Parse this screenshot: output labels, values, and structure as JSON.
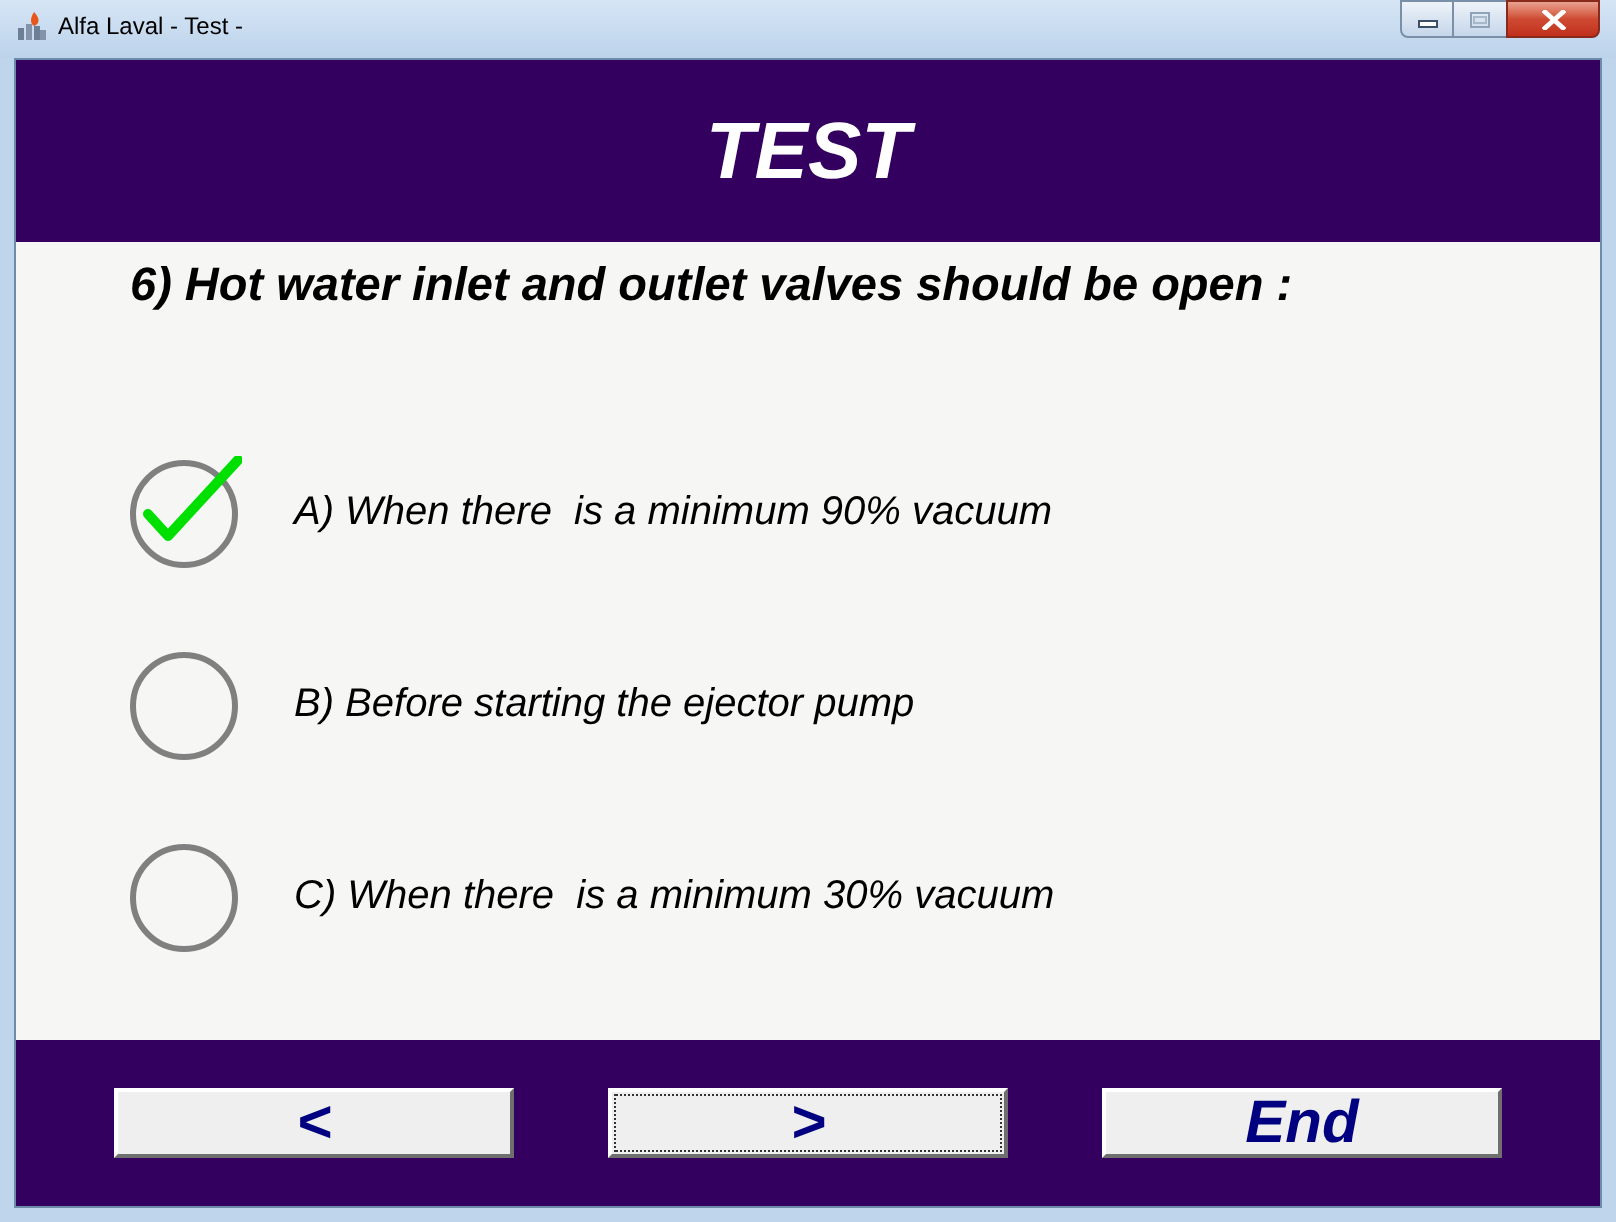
{
  "window": {
    "title": "Alfa Laval - Test -"
  },
  "header": {
    "title": "TEST"
  },
  "question": "6) Hot water inlet and outlet valves should be open :",
  "options": [
    {
      "label": "A) When there  is a minimum 90% vacuum",
      "selected": true
    },
    {
      "label": "B) Before starting the ejector pump",
      "selected": false
    },
    {
      "label": "C) When there  is a minimum 30% vacuum",
      "selected": false
    }
  ],
  "buttons": [
    {
      "label": "<",
      "focused": false
    },
    {
      "label": ">",
      "focused": true
    },
    {
      "label": "End",
      "focused": false
    }
  ]
}
